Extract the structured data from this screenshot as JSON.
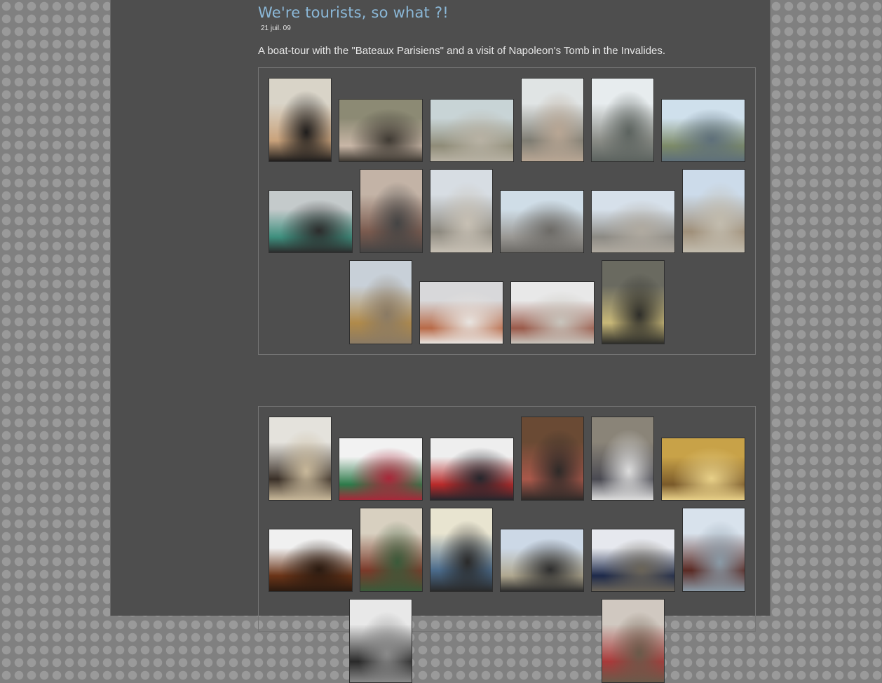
{
  "post": {
    "title": "We're tourists, so what ?!",
    "date": "21 juil. 09",
    "description": "A boat-tour with the \"Bateaux Parisiens\" and a visit of Napoleon's Tomb in the Invalides."
  },
  "galleries": [
    {
      "name": "gallery-1",
      "photos": [
        {
          "colors": [
            "#d9d4c8",
            "#c9a27b",
            "#1f1d1c"
          ]
        },
        {
          "colors": [
            "#8c8a74",
            "#c8b6a6",
            "#3f3a33"
          ]
        },
        {
          "colors": [
            "#c8d4d6",
            "#8f8c78",
            "#b8b2a4"
          ]
        },
        {
          "colors": [
            "#e0e4e4",
            "#7f7d73",
            "#b8a694"
          ]
        },
        {
          "colors": [
            "#e7ecee",
            "#8a8c86",
            "#5c635f"
          ]
        },
        {
          "colors": [
            "#cfe0ec",
            "#7c8a68",
            "#5e6f7a"
          ]
        },
        {
          "colors": [
            "#c4cacb",
            "#3e8f7e",
            "#2c2c2c"
          ]
        },
        {
          "colors": [
            "#c3b3a6",
            "#7a5a4e",
            "#444444"
          ]
        },
        {
          "colors": [
            "#d7dde3",
            "#8e8a80",
            "#c7c0b4"
          ]
        },
        {
          "colors": [
            "#cfdde7",
            "#9a9894",
            "#6c6a66"
          ]
        },
        {
          "colors": [
            "#d6e0ea",
            "#8c8a84",
            "#b0aaa0"
          ]
        },
        {
          "colors": [
            "#ccdbea",
            "#a0907a",
            "#c2bcae"
          ]
        },
        {
          "colors": [
            "#c8d0d8",
            "#b08a4a",
            "#8a7a64"
          ]
        },
        {
          "colors": [
            "#d8d8da",
            "#b86a48",
            "#e8e4e0"
          ]
        },
        {
          "colors": [
            "#e8e8e8",
            "#9a5a4a",
            "#c8c4bc"
          ]
        },
        {
          "colors": [
            "#6a6a60",
            "#c8b878",
            "#2e2e2a"
          ]
        }
      ]
    },
    {
      "name": "gallery-2",
      "photos": [
        {
          "colors": [
            "#e4e2dc",
            "#3a3028",
            "#c8b89a"
          ]
        },
        {
          "colors": [
            "#f2f2f2",
            "#2e7a4a",
            "#a8283a"
          ]
        },
        {
          "colors": [
            "#eeeeee",
            "#b82a2a",
            "#26262c"
          ]
        },
        {
          "colors": [
            "#6a4a34",
            "#a8584a",
            "#2e2a28"
          ]
        },
        {
          "colors": [
            "#8a8478",
            "#4a4a52",
            "#dcdcdc"
          ]
        },
        {
          "colors": [
            "#c8a248",
            "#7a5a2a",
            "#e8d088"
          ]
        },
        {
          "colors": [
            "#f0f0f0",
            "#6a3418",
            "#2a1a10"
          ]
        },
        {
          "colors": [
            "#d8d0c0",
            "#7a3a2a",
            "#3a5a3a"
          ]
        },
        {
          "colors": [
            "#e8e4d0",
            "#4a6a8a",
            "#2a2a2a"
          ]
        },
        {
          "colors": [
            "#ccd8e6",
            "#b0a890",
            "#2e2e2e"
          ]
        },
        {
          "colors": [
            "#e6e8ee",
            "#1e2a4a",
            "#6a6458"
          ]
        },
        {
          "colors": [
            "#d8e2ec",
            "#5a2a24",
            "#8a9aa6"
          ]
        },
        {
          "colors": [
            "#e8e8e8",
            "#2a2a2a",
            "#8a8a8a"
          ]
        },
        {
          "colors": [
            "#d0c8c0",
            "#a83a3a",
            "#6a5a4a"
          ]
        }
      ]
    }
  ]
}
